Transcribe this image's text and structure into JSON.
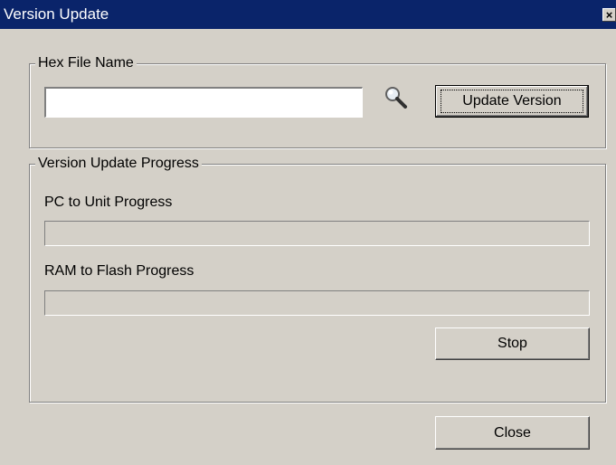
{
  "window": {
    "title": "Version Update",
    "close_glyph": "×"
  },
  "hex_group": {
    "legend": "Hex File Name",
    "file_input": {
      "value": "",
      "placeholder": ""
    },
    "browse_icon": "search-icon",
    "update_button": "Update Version"
  },
  "progress_group": {
    "legend": "Version Update Progress",
    "pc_to_unit": {
      "label": "PC to Unit Progress",
      "progress": 0
    },
    "ram_to_flash": {
      "label": "RAM to Flash Progress",
      "progress": 0
    },
    "stop_button": "Stop"
  },
  "footer": {
    "close_button": "Close"
  },
  "colors": {
    "titlebar": "#0a246a",
    "face": "#d4d0c8"
  }
}
